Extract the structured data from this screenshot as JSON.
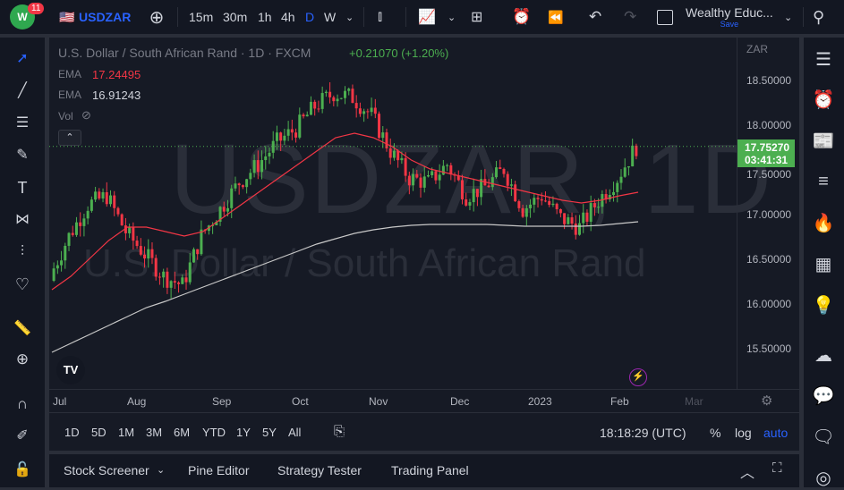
{
  "header": {
    "notifications": "11",
    "symbol": "USDZAR",
    "intervals": [
      "15m",
      "30m",
      "1h",
      "4h",
      "D",
      "W"
    ],
    "active_interval": "D",
    "layout_name": "Wealthy Educ...",
    "save_label": "Save"
  },
  "legend": {
    "title": "U.S. Dollar / South African Rand · 1D · FXCM",
    "change": "+0.21070 (+1.20%)",
    "ema1_label": "EMA",
    "ema1_value": "17.24495",
    "ema2_label": "EMA",
    "ema2_value": "16.91243",
    "vol_label": "Vol"
  },
  "watermark": {
    "symbol": "USDZAR, 1D",
    "name": "U.S. Dollar / South African Rand"
  },
  "price_scale": {
    "currency": "ZAR",
    "ticks": [
      "18.50000",
      "18.00000",
      "17.50000",
      "17.00000",
      "16.50000",
      "16.00000",
      "15.50000"
    ],
    "last_price": "17.75270",
    "countdown": "03:41:31"
  },
  "time_axis": [
    "Jul",
    "Aug",
    "Sep",
    "Oct",
    "Nov",
    "Dec",
    "2023",
    "Feb",
    "Mar"
  ],
  "ranges": [
    "1D",
    "5D",
    "1M",
    "3M",
    "6M",
    "YTD",
    "1Y",
    "5Y",
    "All"
  ],
  "clock": "18:18:29 (UTC)",
  "scale_opts": [
    "%",
    "log",
    "auto"
  ],
  "bottom_tabs": [
    "Stock Screener",
    "Pine Editor",
    "Strategy Tester",
    "Trading Panel"
  ],
  "colors": {
    "up": "#4caf50",
    "down": "#f23645",
    "ema_fast": "#f23645",
    "ema_slow": "#c8c8c8",
    "accent": "#2962ff"
  },
  "chart_data": {
    "type": "candlestick",
    "title": "U.S. Dollar / South African Rand · 1D · FXCM",
    "ylim": [
      15.2,
      18.95
    ],
    "weekly_close": [
      16.3,
      16.75,
      17.1,
      17.2,
      16.8,
      16.55,
      16.3,
      16.2,
      16.75,
      17.05,
      17.35,
      17.55,
      17.8,
      17.95,
      18.2,
      18.35,
      18.3,
      18.1,
      17.7,
      17.4,
      17.35,
      17.55,
      17.2,
      17.3,
      17.5,
      17.05,
      17.2,
      16.95,
      16.85,
      17.15,
      17.4,
      17.75
    ],
    "ema_fast": [
      16.15,
      16.3,
      16.5,
      16.7,
      16.85,
      16.85,
      16.8,
      16.75,
      16.8,
      16.95,
      17.1,
      17.25,
      17.4,
      17.55,
      17.7,
      17.85,
      17.9,
      17.85,
      17.75,
      17.6,
      17.5,
      17.45,
      17.4,
      17.35,
      17.3,
      17.25,
      17.2,
      17.15,
      17.12,
      17.15,
      17.2,
      17.24
    ],
    "ema_slow": [
      15.45,
      15.55,
      15.65,
      15.75,
      15.85,
      15.95,
      16.02,
      16.1,
      16.18,
      16.26,
      16.34,
      16.42,
      16.5,
      16.58,
      16.66,
      16.72,
      16.78,
      16.82,
      16.85,
      16.87,
      16.88,
      16.88,
      16.88,
      16.88,
      16.87,
      16.86,
      16.86,
      16.86,
      16.86,
      16.87,
      16.89,
      16.91
    ]
  }
}
